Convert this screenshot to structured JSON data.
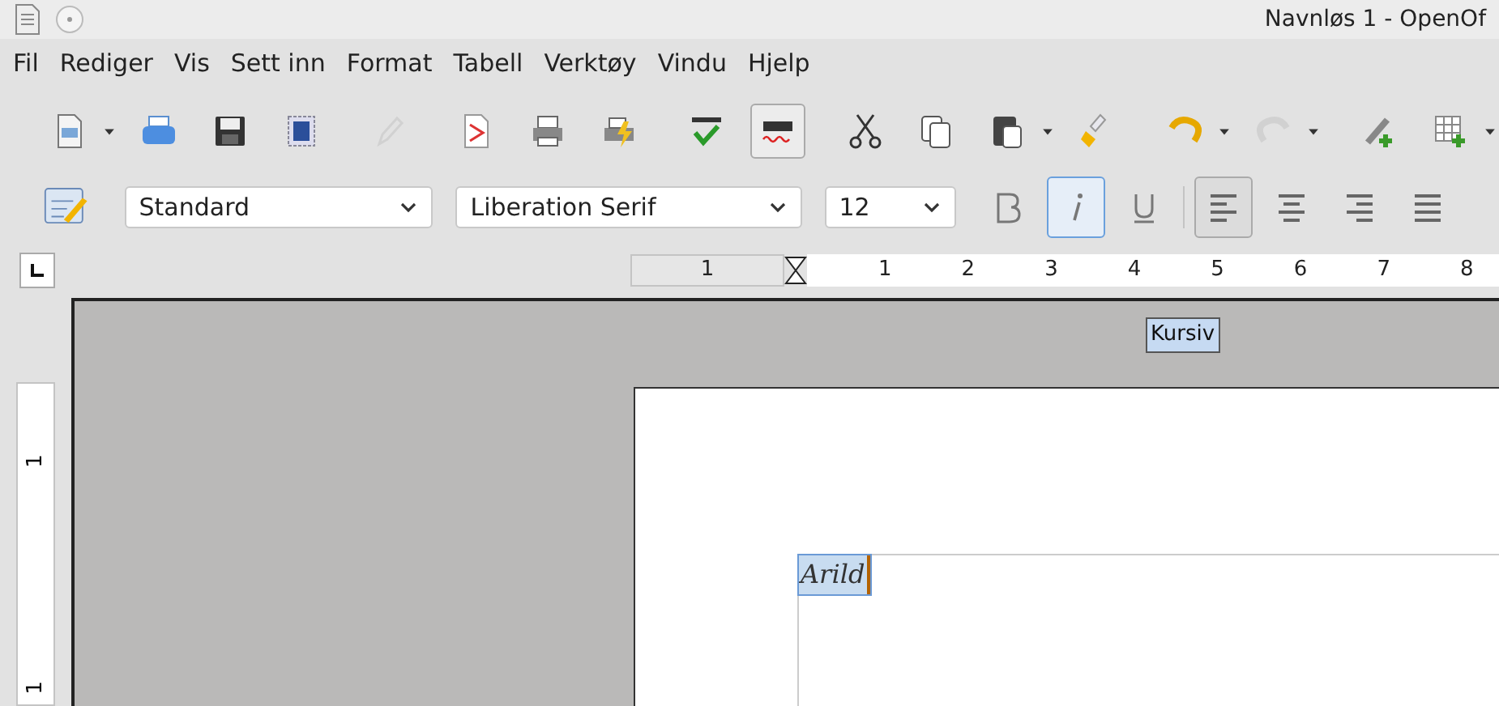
{
  "window": {
    "title": "Navnløs 1 - OpenOf"
  },
  "menu": [
    "Fil",
    "Rediger",
    "Vis",
    "Sett inn",
    "Format",
    "Tabell",
    "Verktøy",
    "Vindu",
    "Hjelp"
  ],
  "toolbar": [
    {
      "kind": "new",
      "dropdown": true,
      "disabled": false,
      "selected": false
    },
    {
      "kind": "open",
      "dropdown": false,
      "disabled": false,
      "selected": false
    },
    {
      "kind": "save",
      "dropdown": false,
      "disabled": false,
      "selected": false
    },
    {
      "kind": "mail",
      "dropdown": false,
      "disabled": false,
      "selected": false
    },
    {
      "kind": "sep"
    },
    {
      "kind": "edit",
      "dropdown": false,
      "disabled": true,
      "selected": false
    },
    {
      "kind": "sep"
    },
    {
      "kind": "pdf",
      "dropdown": false,
      "disabled": false,
      "selected": false
    },
    {
      "kind": "print",
      "dropdown": false,
      "disabled": false,
      "selected": false
    },
    {
      "kind": "printdirect",
      "dropdown": false,
      "disabled": false,
      "selected": false
    },
    {
      "kind": "sep"
    },
    {
      "kind": "spell",
      "dropdown": false,
      "disabled": false,
      "selected": false
    },
    {
      "kind": "autospell",
      "dropdown": false,
      "disabled": false,
      "selected": true
    },
    {
      "kind": "sep"
    },
    {
      "kind": "cut",
      "dropdown": false,
      "disabled": false,
      "selected": false
    },
    {
      "kind": "copy",
      "dropdown": false,
      "disabled": false,
      "selected": false
    },
    {
      "kind": "paste",
      "dropdown": true,
      "disabled": false,
      "selected": false
    },
    {
      "kind": "brush",
      "dropdown": false,
      "disabled": false,
      "selected": false
    },
    {
      "kind": "sep"
    },
    {
      "kind": "undo",
      "dropdown": true,
      "disabled": false,
      "selected": false
    },
    {
      "kind": "redo",
      "dropdown": true,
      "disabled": true,
      "selected": false
    },
    {
      "kind": "sep"
    },
    {
      "kind": "hyperlink",
      "dropdown": false,
      "disabled": false,
      "selected": false
    },
    {
      "kind": "table",
      "dropdown": true,
      "disabled": false,
      "selected": false
    }
  ],
  "formatting": {
    "style": "Standard",
    "font": "Liberation Serif",
    "size": "12",
    "buttons": [
      {
        "kind": "bold",
        "selected": false
      },
      {
        "kind": "italic",
        "selected": true
      },
      {
        "kind": "underline",
        "selected": false
      },
      {
        "kind": "sep"
      },
      {
        "kind": "left",
        "selected": true
      },
      {
        "kind": "center",
        "selected": false
      },
      {
        "kind": "right",
        "selected": false
      },
      {
        "kind": "justify",
        "selected": false
      }
    ]
  },
  "ruler": {
    "left_numbers": [
      "1"
    ],
    "numbers": [
      "1",
      "2",
      "3",
      "4",
      "5",
      "6",
      "7",
      "8"
    ],
    "tooltip": "Kursiv"
  },
  "vertical_ruler": [
    "1",
    "1"
  ],
  "document": {
    "text": "Arild",
    "selected": true
  }
}
